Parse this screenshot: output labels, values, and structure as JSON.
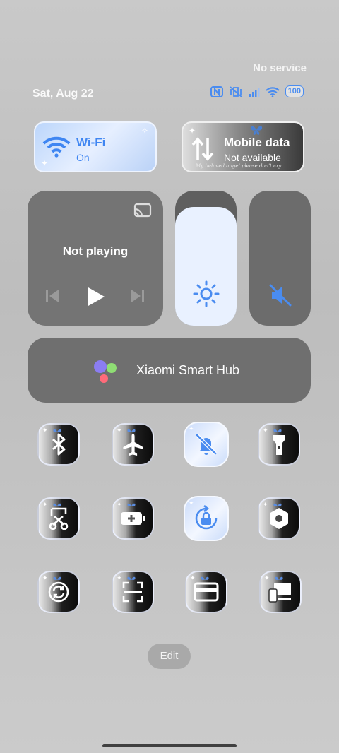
{
  "status": {
    "service": "No service",
    "date": "Sat, Aug 22",
    "battery": "100",
    "icons": [
      "nfc-icon",
      "vibrate-off-icon",
      "signal-icon",
      "wifi-icon",
      "battery-icon"
    ],
    "accent": "#4a8cf0"
  },
  "tiles": {
    "wifi": {
      "label": "Wi-Fi",
      "status": "On"
    },
    "mobile": {
      "label": "Mobile data",
      "status": "Not available",
      "caption": "My beloved angel please don't cry"
    }
  },
  "media": {
    "title": "Not playing"
  },
  "brightness": {
    "level": 0.88
  },
  "volume": {
    "muted": true
  },
  "hub": {
    "label": "Xiaomi Smart Hub"
  },
  "toggles": [
    {
      "name": "bluetooth",
      "active": false
    },
    {
      "name": "airplane-mode",
      "active": false
    },
    {
      "name": "silent-mode",
      "active": true
    },
    {
      "name": "flashlight",
      "active": false
    },
    {
      "name": "screenshot",
      "active": false
    },
    {
      "name": "battery-saver",
      "active": false
    },
    {
      "name": "rotation-lock",
      "active": true
    },
    {
      "name": "settings",
      "active": false
    },
    {
      "name": "sync",
      "active": false
    },
    {
      "name": "scanner",
      "active": false
    },
    {
      "name": "cards",
      "active": false
    },
    {
      "name": "cast-screen",
      "active": false
    }
  ],
  "footer": {
    "edit": "Edit"
  }
}
